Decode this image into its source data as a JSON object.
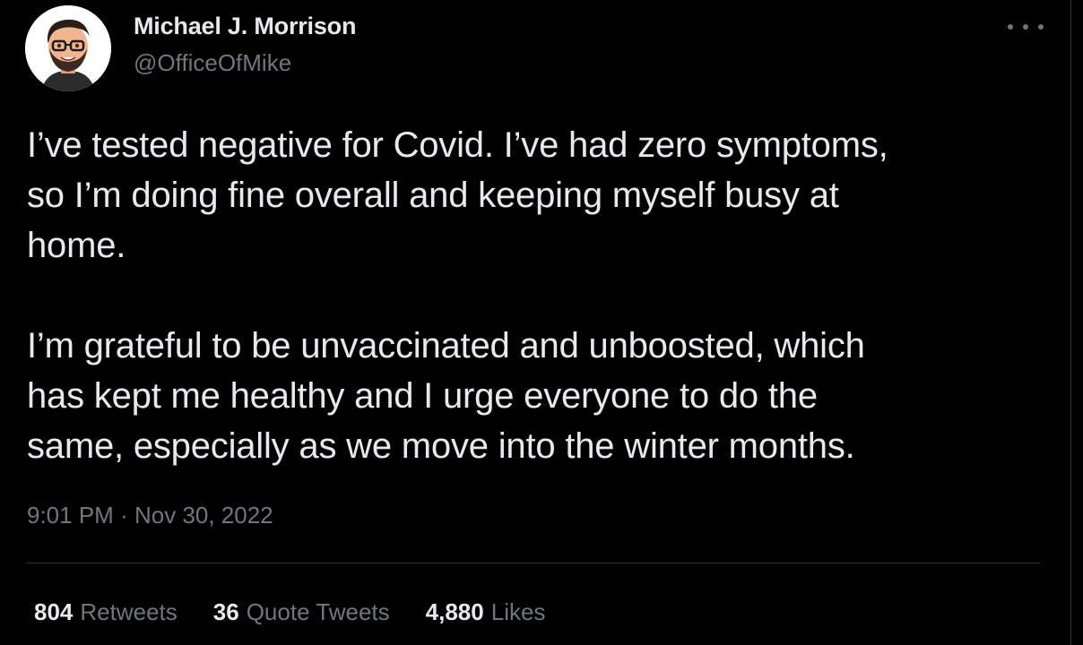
{
  "author": {
    "display_name": "Michael J. Morrison",
    "handle": "@OfficeOfMike",
    "avatar_icon": "bitmoji-avatar"
  },
  "tweet": {
    "paragraph1": [
      "I’ve tested negative for Covid. I’ve had zero symptoms,",
      "so I’m doing fine overall and keeping myself busy at",
      "home."
    ],
    "paragraph2": [
      "I’m grateful to be unvaccinated and unboosted, which",
      "has kept me healthy and I urge everyone to do the",
      "same, especially as we move into the winter months."
    ],
    "time": "9:01 PM",
    "separator": "·",
    "date": "Nov 30, 2022"
  },
  "stats": {
    "retweets_count": "804",
    "retweets_label": "Retweets",
    "quotes_count": "36",
    "quotes_label": "Quote Tweets",
    "likes_count": "4,880",
    "likes_label": "Likes"
  },
  "menu": {
    "icon": "more-horizontal-icon"
  },
  "colors": {
    "background": "#000000",
    "primary_text": "#e7e9ea",
    "secondary_text": "#71767b",
    "divider": "#2f3336"
  }
}
